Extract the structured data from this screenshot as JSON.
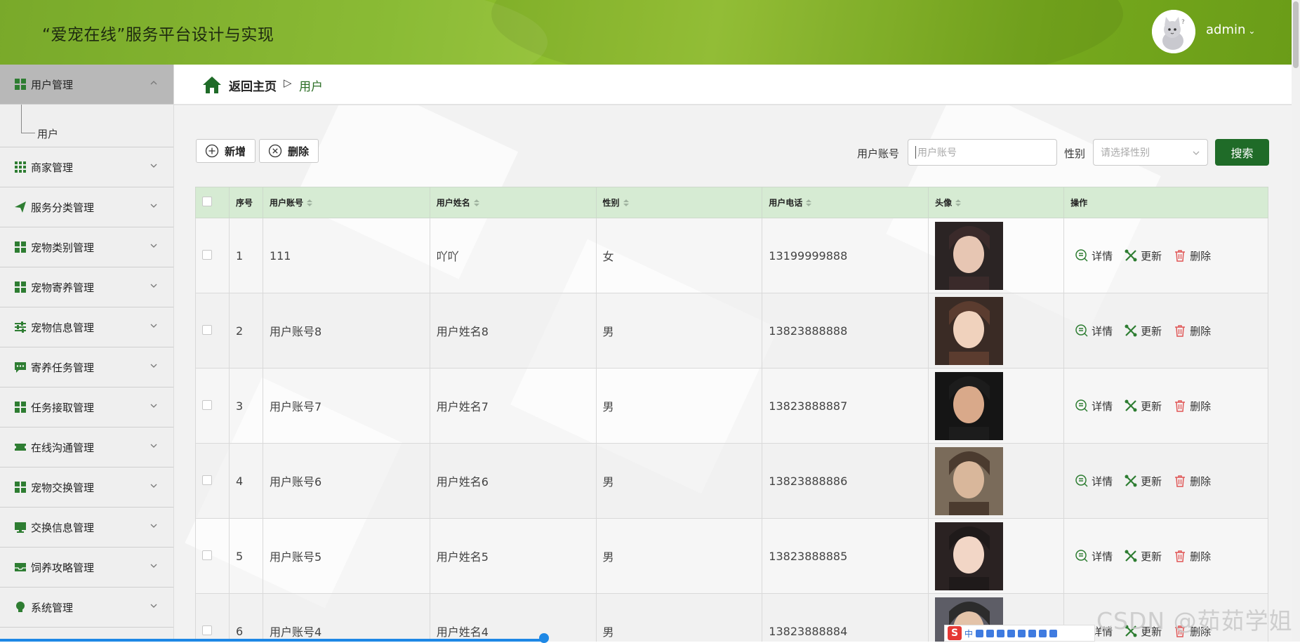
{
  "header": {
    "title": "“爱宠在线”服务平台设计与实现",
    "user": "admin",
    "caret": "⌄"
  },
  "sidebar": {
    "items": [
      {
        "label": "用户管理",
        "icon": "grid-icon",
        "expanded": true
      },
      {
        "label": "商家管理",
        "icon": "apps-icon"
      },
      {
        "label": "服务分类管理",
        "icon": "send-icon"
      },
      {
        "label": "宠物类别管理",
        "icon": "grid-icon"
      },
      {
        "label": "宠物寄养管理",
        "icon": "grid-icon"
      },
      {
        "label": "宠物信息管理",
        "icon": "sliders-icon"
      },
      {
        "label": "寄养任务管理",
        "icon": "chat-icon"
      },
      {
        "label": "任务接取管理",
        "icon": "grid-icon"
      },
      {
        "label": "在线沟通管理",
        "icon": "ticket-icon"
      },
      {
        "label": "宠物交换管理",
        "icon": "grid-icon"
      },
      {
        "label": "交换信息管理",
        "icon": "monitor-icon"
      },
      {
        "label": "饲养攻略管理",
        "icon": "inbox-icon"
      },
      {
        "label": "系统管理",
        "icon": "bulb-icon"
      }
    ],
    "sub_item": "用户"
  },
  "breadcrumb": {
    "home": "返回主页",
    "separator": "▷",
    "current": "用户"
  },
  "toolbar": {
    "add_label": "新增",
    "delete_label": "删除",
    "account_label": "用户账号",
    "account_placeholder": "用户账号",
    "gender_label": "性别",
    "gender_placeholder": "请选择性别",
    "search_label": "搜索"
  },
  "table": {
    "headers": [
      "序号",
      "用户账号",
      "用户姓名",
      "性别",
      "用户电话",
      "头像",
      "操作"
    ],
    "rows": [
      {
        "no": "1",
        "account": "111",
        "name": "吖吖",
        "gender": "女",
        "phone": "13199999888"
      },
      {
        "no": "2",
        "account": "用户账号8",
        "name": "用户姓名8",
        "gender": "男",
        "phone": "13823888888"
      },
      {
        "no": "3",
        "account": "用户账号7",
        "name": "用户姓名7",
        "gender": "男",
        "phone": "13823888887"
      },
      {
        "no": "4",
        "account": "用户账号6",
        "name": "用户姓名6",
        "gender": "男",
        "phone": "13823888886"
      },
      {
        "no": "5",
        "account": "用户账号5",
        "name": "用户姓名5",
        "gender": "男",
        "phone": "13823888885"
      },
      {
        "no": "6",
        "account": "用户账号4",
        "name": "用户姓名4",
        "gender": "男",
        "phone": "13823888884"
      }
    ],
    "ops": {
      "detail": "详情",
      "update": "更新",
      "delete": "删除"
    }
  },
  "ime": {
    "s": "S",
    "lang": "中"
  },
  "watermark": "CSDN @茹茹学姐",
  "colors": {
    "header_green": "#82b626",
    "primary_green": "#1f6b28",
    "table_header": "#d6ebd3",
    "delete_red": "#e05555"
  }
}
